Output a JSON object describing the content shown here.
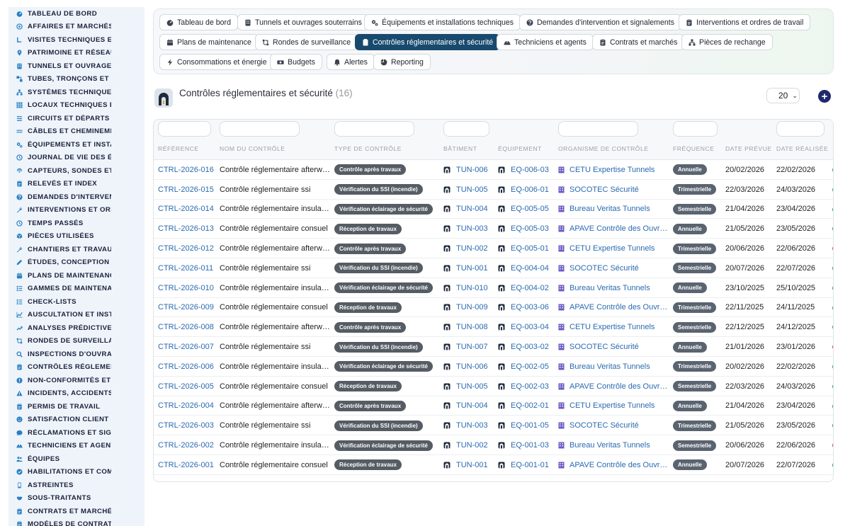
{
  "sidebar": {
    "items": [
      {
        "label": "TABLEAU DE BORD",
        "icon": "dashboard-icon"
      },
      {
        "label": "AFFAIRES ET MARCHÉS",
        "icon": "target-icon"
      },
      {
        "label": "VISITES TECHNIQUES ET",
        "icon": "walk-icon"
      },
      {
        "label": "PATRIMOINE ET RÉSEAUX",
        "icon": "pin-icon"
      },
      {
        "label": "TUNNELS ET OUVRAGES",
        "icon": "tunnel-icon"
      },
      {
        "label": "TUBES, TRONÇONS ET ZO",
        "icon": "segments-icon"
      },
      {
        "label": "SYSTÈMES TECHNIQUES",
        "icon": "network-icon"
      },
      {
        "label": "LOCAUX TECHNIQUES ET",
        "icon": "grid-icon"
      },
      {
        "label": "CIRCUITS ET DÉPARTS É",
        "icon": "circuit-icon"
      },
      {
        "label": "CÂBLES ET CHEMINEMEN",
        "icon": "cable-icon"
      },
      {
        "label": "ÉQUIPEMENTS ET INSTAL",
        "icon": "gears-icon"
      },
      {
        "label": "JOURNAL DE VIE DES ÉQ",
        "icon": "history-icon"
      },
      {
        "label": "CAPTEURS, SONDES ET C",
        "icon": "sensor-icon"
      },
      {
        "label": "RELEVÉS ET INDEX",
        "icon": "clipboard-icon"
      },
      {
        "label": "DEMANDES D'INTERVENT",
        "icon": "question-icon"
      },
      {
        "label": "INTERVENTIONS ET ORDI",
        "icon": "wrench-icon"
      },
      {
        "label": "TEMPS PASSÉS",
        "icon": "clock-icon"
      },
      {
        "label": "PIÈCES UTILISÉES",
        "icon": "box-icon"
      },
      {
        "label": "CHANTIERS ET TRAVAUX",
        "icon": "hammer-icon"
      },
      {
        "label": "ÉTUDES, CONCEPTION ET",
        "icon": "pencil-icon"
      },
      {
        "label": "PLANS DE MAINTENANCE",
        "icon": "calendar-icon"
      },
      {
        "label": "GAMMES DE MAINTENAN",
        "icon": "list-icon"
      },
      {
        "label": "CHECK-LISTS",
        "icon": "checklist-icon"
      },
      {
        "label": "AUSCULTATION ET INSTR",
        "icon": "chart-icon"
      },
      {
        "label": "ANALYSES PRÉDICTIVES",
        "icon": "trend-icon"
      },
      {
        "label": "RONDES DE SURVEILLAN",
        "icon": "route-icon"
      },
      {
        "label": "INSPECTIONS D'OUVRAG",
        "icon": "search-icon"
      },
      {
        "label": "CONTRÔLES RÉGLEMENT",
        "icon": "clipboard-check-icon"
      },
      {
        "label": "NON-CONFORMITÉS ET A",
        "icon": "alert-circle-icon"
      },
      {
        "label": "INCIDENTS, ACCIDENTS E",
        "icon": "warning-icon"
      },
      {
        "label": "PERMIS DE TRAVAIL",
        "icon": "document-icon"
      },
      {
        "label": "SATISFACTION CLIENT",
        "icon": "smile-icon"
      },
      {
        "label": "RÉCLAMATIONS ET SIGN",
        "icon": "chat-icon"
      },
      {
        "label": "TECHNICIENS ET AGENTS",
        "icon": "helmet-icon"
      },
      {
        "label": "ÉQUIPES",
        "icon": "users-icon"
      },
      {
        "label": "HABILITATIONS ET COMP",
        "icon": "badge-icon"
      },
      {
        "label": "ASTREINTES",
        "icon": "phone-icon"
      },
      {
        "label": "SOUS-TRAITANTS",
        "icon": "handshake-icon"
      },
      {
        "label": "CONTRATS ET MARCHÉS",
        "icon": "contract-icon"
      },
      {
        "label": "MODÈLES DE CONTRATS",
        "icon": "template-icon"
      }
    ]
  },
  "tabs": [
    {
      "label": "Tableau de bord",
      "icon": "dashboard-icon",
      "active": false
    },
    {
      "label": "Tunnels et ouvrages souterrains",
      "icon": "building-icon",
      "active": false
    },
    {
      "label": "Équipements et installations techniques",
      "icon": "gears-icon",
      "active": false
    },
    {
      "label": "Demandes d'intervention et signalements",
      "icon": "question-icon",
      "active": false
    },
    {
      "label": "Interventions et ordres de travail",
      "icon": "clipboard-icon",
      "active": false
    },
    {
      "label": "Plans de maintenance",
      "icon": "calendar-icon",
      "active": false
    },
    {
      "label": "Rondes de surveillance",
      "icon": "route-icon",
      "active": false
    },
    {
      "label": "Contrôles réglementaires et sécurité",
      "icon": "clipboard-check-icon",
      "active": true
    },
    {
      "label": "Techniciens et agents",
      "icon": "helmet-icon",
      "active": false
    },
    {
      "label": "Contrats et marchés",
      "icon": "contract-icon",
      "active": false
    },
    {
      "label": "Pièces de rechange",
      "icon": "boxes-icon",
      "active": false
    },
    {
      "label": "Consommations et énergie",
      "icon": "bolt-icon",
      "active": false
    },
    {
      "label": "Budgets",
      "icon": "money-icon",
      "active": false
    },
    {
      "label": "Alertes",
      "icon": "bell-icon",
      "active": false
    },
    {
      "label": "Reporting",
      "icon": "pie-icon",
      "active": false
    }
  ],
  "page": {
    "title": "Contrôles réglementaires et sécurité",
    "count": "(16)",
    "page_size": "20"
  },
  "table": {
    "columns": [
      "RÉFÉRENCE",
      "NOM DU CONTRÔLE",
      "TYPE DE CONTRÔLE",
      "BÂTIMENT",
      "ÉQUIPEMENT",
      "ORGANISME DE CONTRÔLE",
      "FRÉQUENCE",
      "DATE PRÉVUE",
      "DATE RÉALISÉE"
    ],
    "rows": [
      {
        "ref": "CTRL-2026-016",
        "nom": "Contrôle réglementaire afterw…",
        "type": "Contrôle après travaux",
        "bat": "TUN-006",
        "eq": "EQ-006-03",
        "org": "CETU Expertise Tunnels",
        "freq": "Annuelle",
        "prevue": "20/02/2026",
        "realisee": "22/02/2026",
        "status_color": "#2e9e4f"
      },
      {
        "ref": "CTRL-2026-015",
        "nom": "Contrôle réglementaire ssi",
        "type": "Vérification du SSI (incendie)",
        "bat": "TUN-005",
        "eq": "EQ-006-01",
        "org": "SOCOTEC Sécurité",
        "freq": "Trimestrielle",
        "prevue": "22/03/2026",
        "realisee": "24/03/2026",
        "status_color": "#2e9e4f"
      },
      {
        "ref": "CTRL-2026-014",
        "nom": "Contrôle réglementaire insula…",
        "type": "Vérification éclairage de sécurité",
        "bat": "TUN-004",
        "eq": "EQ-005-05",
        "org": "Bureau Veritas Tunnels",
        "freq": "Semestrielle",
        "prevue": "21/04/2026",
        "realisee": "23/04/2026",
        "status_color": "#2e9e4f"
      },
      {
        "ref": "CTRL-2026-013",
        "nom": "Contrôle réglementaire consuel",
        "type": "Réception de travaux",
        "bat": "TUN-003",
        "eq": "EQ-005-03",
        "org": "APAVE Contrôle des Ouvr…",
        "freq": "Annuelle",
        "prevue": "21/05/2026",
        "realisee": "23/05/2026",
        "status_color": "#2e9e4f"
      },
      {
        "ref": "CTRL-2026-012",
        "nom": "Contrôle réglementaire afterw…",
        "type": "Contrôle après travaux",
        "bat": "TUN-002",
        "eq": "EQ-005-01",
        "org": "CETU Expertise Tunnels",
        "freq": "Trimestrielle",
        "prevue": "20/06/2026",
        "realisee": "22/06/2026",
        "status_color": "#d94040"
      },
      {
        "ref": "CTRL-2026-011",
        "nom": "Contrôle réglementaire ssi",
        "type": "Vérification du SSI (incendie)",
        "bat": "TUN-001",
        "eq": "EQ-004-04",
        "org": "SOCOTEC Sécurité",
        "freq": "Semestrielle",
        "prevue": "20/07/2026",
        "realisee": "22/07/2026",
        "status_color": "#2e9e4f"
      },
      {
        "ref": "CTRL-2026-010",
        "nom": "Contrôle réglementaire insula…",
        "type": "Vérification éclairage de sécurité",
        "bat": "TUN-010",
        "eq": "EQ-004-02",
        "org": "Bureau Veritas Tunnels",
        "freq": "Annuelle",
        "prevue": "23/10/2025",
        "realisee": "25/10/2025",
        "status_color": "#2e9e4f"
      },
      {
        "ref": "CTRL-2026-009",
        "nom": "Contrôle réglementaire consuel",
        "type": "Réception de travaux",
        "bat": "TUN-009",
        "eq": "EQ-003-06",
        "org": "APAVE Contrôle des Ouvr…",
        "freq": "Trimestrielle",
        "prevue": "22/11/2025",
        "realisee": "24/11/2025",
        "status_color": "#2e9e4f"
      },
      {
        "ref": "CTRL-2026-008",
        "nom": "Contrôle réglementaire afterw…",
        "type": "Contrôle après travaux",
        "bat": "TUN-008",
        "eq": "EQ-003-04",
        "org": "CETU Expertise Tunnels",
        "freq": "Semestrielle",
        "prevue": "22/12/2025",
        "realisee": "24/12/2025",
        "status_color": "#2e9e4f"
      },
      {
        "ref": "CTRL-2026-007",
        "nom": "Contrôle réglementaire ssi",
        "type": "Vérification du SSI (incendie)",
        "bat": "TUN-007",
        "eq": "EQ-003-02",
        "org": "SOCOTEC Sécurité",
        "freq": "Annuelle",
        "prevue": "21/01/2026",
        "realisee": "23/01/2026",
        "status_color": "#d94040"
      },
      {
        "ref": "CTRL-2026-006",
        "nom": "Contrôle réglementaire insula…",
        "type": "Vérification éclairage de sécurité",
        "bat": "TUN-006",
        "eq": "EQ-002-05",
        "org": "Bureau Veritas Tunnels",
        "freq": "Trimestrielle",
        "prevue": "20/02/2026",
        "realisee": "22/02/2026",
        "status_color": "#2e9e4f"
      },
      {
        "ref": "CTRL-2026-005",
        "nom": "Contrôle réglementaire consuel",
        "type": "Réception de travaux",
        "bat": "TUN-005",
        "eq": "EQ-002-03",
        "org": "APAVE Contrôle des Ouvr…",
        "freq": "Semestrielle",
        "prevue": "22/03/2026",
        "realisee": "24/03/2026",
        "status_color": "#2e9e4f"
      },
      {
        "ref": "CTRL-2026-004",
        "nom": "Contrôle réglementaire afterw…",
        "type": "Contrôle après travaux",
        "bat": "TUN-004",
        "eq": "EQ-002-01",
        "org": "CETU Expertise Tunnels",
        "freq": "Annuelle",
        "prevue": "21/04/2026",
        "realisee": "23/04/2026",
        "status_color": "#2e9e4f"
      },
      {
        "ref": "CTRL-2026-003",
        "nom": "Contrôle réglementaire ssi",
        "type": "Vérification du SSI (incendie)",
        "bat": "TUN-003",
        "eq": "EQ-001-05",
        "org": "SOCOTEC Sécurité",
        "freq": "Trimestrielle",
        "prevue": "21/05/2026",
        "realisee": "23/05/2026",
        "status_color": "#2e9e4f"
      },
      {
        "ref": "CTRL-2026-002",
        "nom": "Contrôle réglementaire insula…",
        "type": "Vérification éclairage de sécurité",
        "bat": "TUN-002",
        "eq": "EQ-001-03",
        "org": "Bureau Veritas Tunnels",
        "freq": "Semestrielle",
        "prevue": "20/06/2026",
        "realisee": "22/06/2026",
        "status_color": "#d94040"
      },
      {
        "ref": "CTRL-2026-001",
        "nom": "Contrôle réglementaire consuel",
        "type": "Réception de travaux",
        "bat": "TUN-001",
        "eq": "EQ-001-01",
        "org": "APAVE Contrôle des Ouvr…",
        "freq": "Annuelle",
        "prevue": "20/07/2026",
        "realisee": "22/07/2026",
        "status_color": "#2e9e4f"
      }
    ]
  },
  "colors": {
    "link": "#2a6ab0",
    "active_tab": "#184a6e",
    "add_button": "#1f2a6b",
    "sidebar_bg": "#eef4fa",
    "status_ok": "#2e9e4f",
    "status_ko": "#d94040"
  }
}
